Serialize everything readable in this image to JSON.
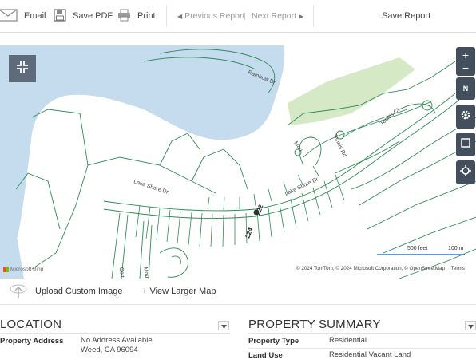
{
  "toolbar": {
    "email": "Email",
    "save_pdf": "Save PDF",
    "print": "Print",
    "previous_report": "Previous Report",
    "next_report": "Next Report",
    "save_report": "Save Report"
  },
  "map": {
    "zoom_in": "+",
    "zoom_out": "−",
    "compass": "N",
    "scale_feet": "500 feet",
    "scale_m": "100 m",
    "attribution": "© 2024 TomTom, © 2024 Microsoft Corporation, © OpenStreetMap",
    "terms": "Terms",
    "bing": "Microsoft Bing",
    "streets": [
      "Rainbow Dr",
      "Lake Shore Dr",
      "Lake Shore Dr",
      "Tennis Ct",
      "Tennis Rd",
      "Mau",
      "Mou",
      "Cott"
    ],
    "parcel_labels": [
      "222",
      "224"
    ],
    "colors": {
      "water": "#c5dcef",
      "park": "#d6e9c6",
      "lines": "#2e8b57",
      "controls": "#434f5c"
    }
  },
  "under": {
    "upload": "Upload Custom Image",
    "larger": "+ View Larger Map"
  },
  "location": {
    "title": "LOCATION",
    "label": "Property Address",
    "line1": "No Address Available",
    "line2": "Weed, CA 96094"
  },
  "summary": {
    "title": "PROPERTY SUMMARY",
    "type_label": "Property Type",
    "type_value": "Residential",
    "use_label": "Land Use",
    "use_value": "Residential Vacant Land"
  }
}
